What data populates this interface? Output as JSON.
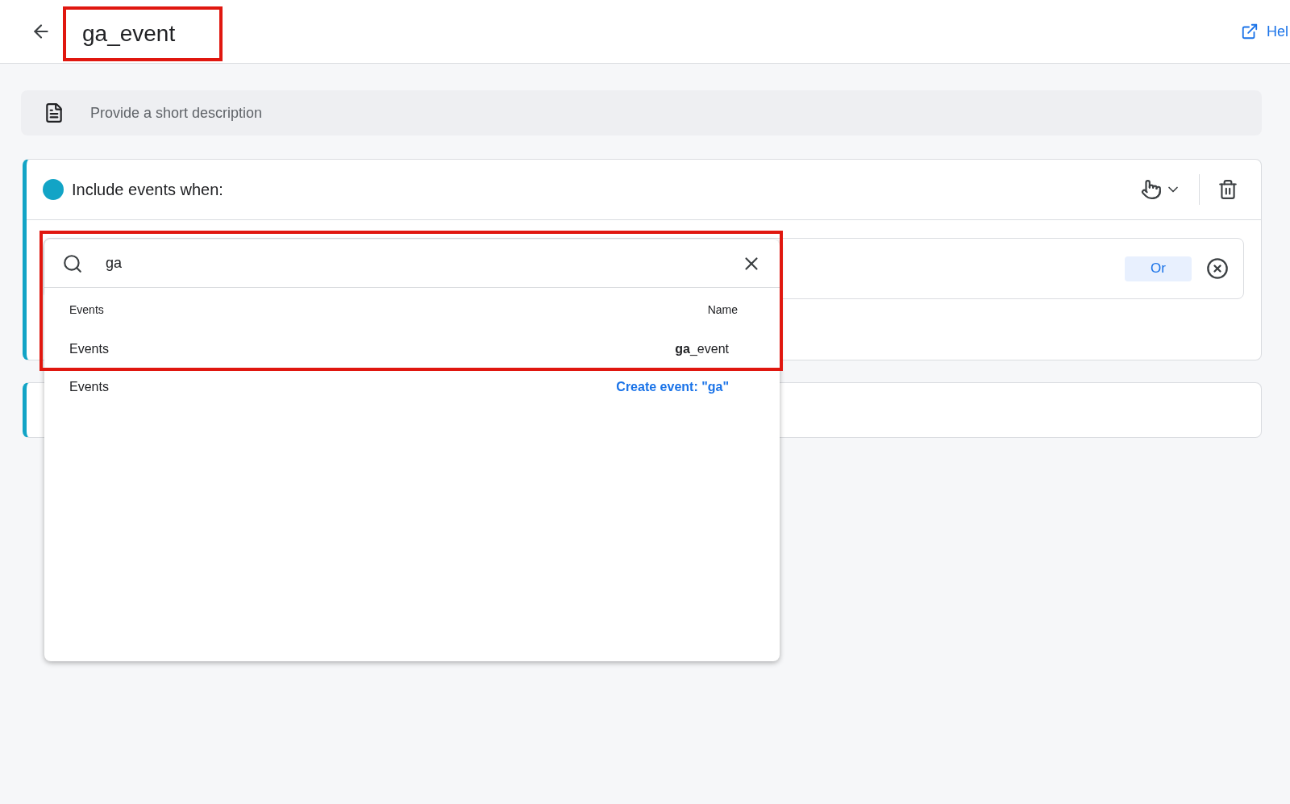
{
  "header": {
    "title": "ga_event",
    "title_highlighted": true,
    "help_link": "Hel"
  },
  "description": {
    "placeholder": "Provide a short description"
  },
  "condition_card": {
    "title": "Include events when:",
    "or_button": "Or"
  },
  "dropdown": {
    "search_value": "ga",
    "top_highlighted": true,
    "columns": [
      "Events",
      "Name"
    ],
    "results": [
      {
        "kind": "match",
        "category": "Events",
        "name": "**ga**_event"
      },
      {
        "kind": "create",
        "category": "Events",
        "name": "Create event: \"ga\""
      }
    ]
  }
}
